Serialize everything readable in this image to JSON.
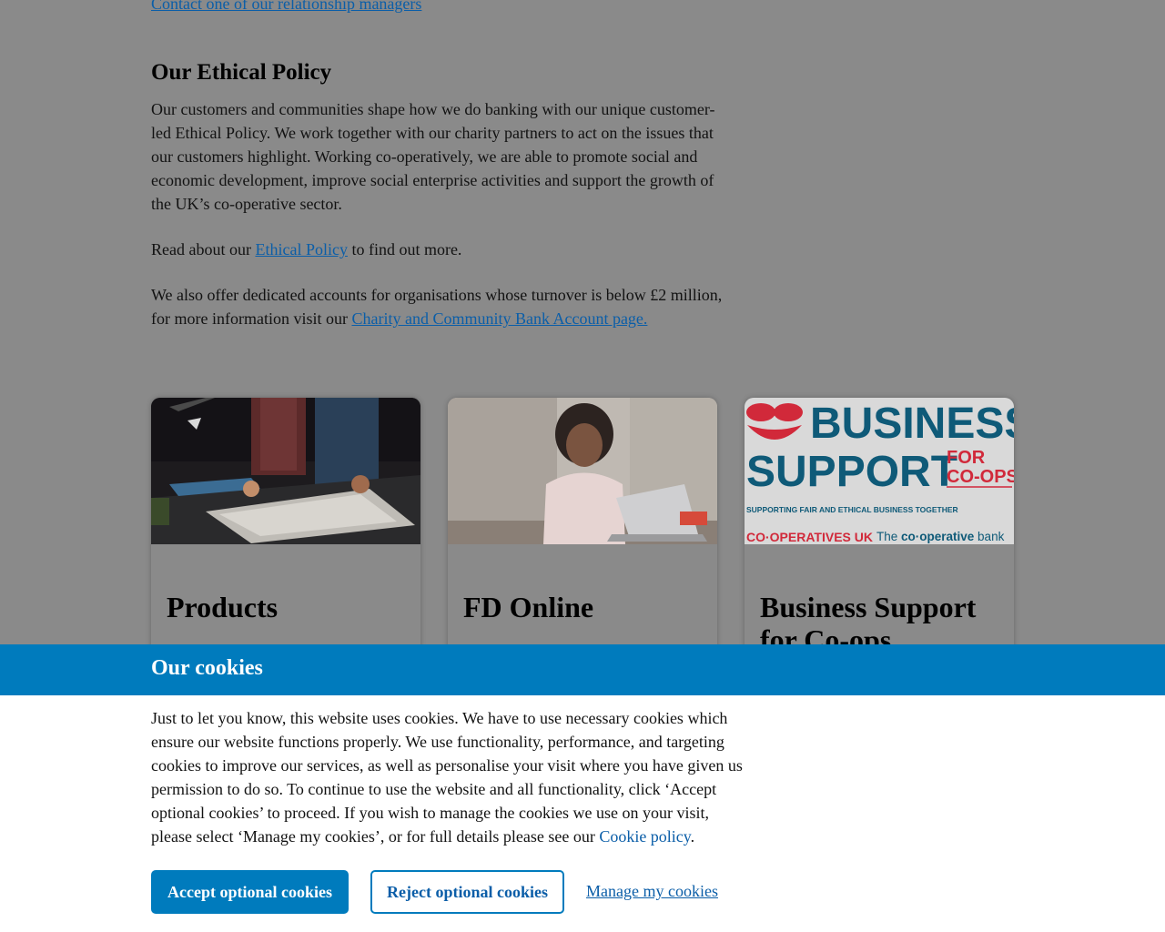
{
  "top_link": "Contact one of our relationship managers",
  "ethical": {
    "title": "Our Ethical Policy",
    "paragraph1": "Our customers and communities shape how we do banking with our unique customer-led Ethical Policy. We work together with our charity partners to act on the issues that our customers highlight. Working co-operatively, we are able to promote social and economic development, improve social enterprise activities and support the growth of the UK’s co-operative sector.",
    "read_prefix": "Read about our ",
    "read_link": "Ethical Policy",
    "read_suffix": " to find out more.",
    "accounts_prefix": "We also offer dedicated accounts for organisations whose turnover is below £2 million, for more information visit our ",
    "accounts_link": "Charity and Community Bank Account page."
  },
  "cards": [
    {
      "title": "Products"
    },
    {
      "title": "FD Online"
    },
    {
      "title": "Business Support for Co-ops",
      "banner": {
        "line1": "BUSINESS",
        "line2": "SUPPORT",
        "for": "FOR",
        "coops": "CO-OPS",
        "tagline": "SUPPORTING FAIR AND ETHICAL BUSINESS TOGETHER",
        "logo_left": "CO·OPERATIVES UK",
        "logo_right_prefix": "The ",
        "logo_right_bold": "co·operative",
        "logo_right_suffix": " bank"
      }
    }
  ],
  "cookies": {
    "title": "Our cookies",
    "text": "Just to let you know, this website uses cookies. We have to use necessary cookies which ensure our website functions properly. We use functionality, performance, and targeting cookies to improve our services, as well as personalise your visit where you have given us permission to do so. To continue to use the website and all functionality, click ‘Accept optional cookies’ to proceed. If you wish to manage the cookies we use on your visit, please select ‘Manage my cookies’, or for full details please see our ",
    "policy_link": "Cookie policy",
    "text_end": ".",
    "accept_label": "Accept optional cookies",
    "reject_label": "Reject optional cookies",
    "manage_label": "Manage my cookies"
  },
  "colors": {
    "overlay": "#8a8a8a",
    "accent_blue": "#007bbd",
    "link": "#0b5ea8",
    "brand_red": "#d1293a",
    "brand_teal": "#0f5a78"
  }
}
